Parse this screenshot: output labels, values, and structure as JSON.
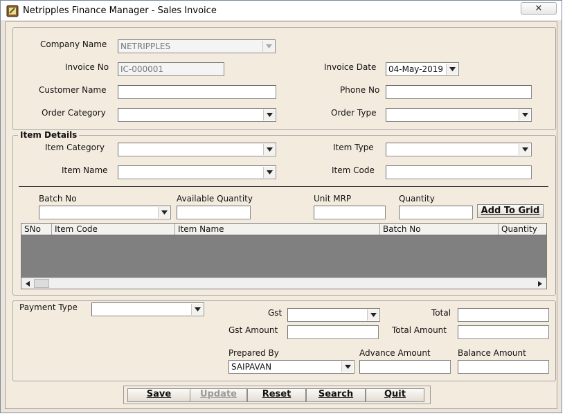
{
  "window": {
    "title": "Netripples Finance Manager - Sales Invoice",
    "close_icon": "close-icon"
  },
  "header": {
    "company_name_label": "Company Name",
    "company_name_value": "NETRIPPLES",
    "invoice_no_label": "Invoice No",
    "invoice_no_value": "IC-000001",
    "invoice_date_label": "Invoice Date",
    "invoice_date_value": "04-May-2019",
    "customer_name_label": "Customer Name",
    "customer_name_value": "",
    "phone_no_label": "Phone No",
    "phone_no_value": "",
    "order_category_label": "Order Category",
    "order_category_value": "",
    "order_type_label": "Order Type",
    "order_type_value": ""
  },
  "item_details": {
    "title": "Item Details",
    "item_category_label": "Item Category",
    "item_type_label": "Item Type",
    "item_name_label": "Item Name",
    "item_code_label": "Item Code",
    "batch_no_label": "Batch No",
    "available_quantity_label": "Available Quantity",
    "unit_mrp_label": "Unit MRP",
    "quantity_label": "Quantity",
    "add_to_grid_label": "Add To Grid",
    "grid_columns": [
      "SNo",
      "Item Code",
      "Item Name",
      "Batch No",
      "Quantity"
    ]
  },
  "payment": {
    "payment_type_label": "Payment Type",
    "gst_label": "Gst",
    "total_label": "Total",
    "gst_amount_label": "Gst Amount",
    "total_amount_label": "Total Amount",
    "prepared_by_label": "Prepared By",
    "prepared_by_value": "SAIPAVAN",
    "advance_amount_label": "Advance Amount",
    "balance_amount_label": "Balance Amount"
  },
  "actions": {
    "save": "Save",
    "update": "Update",
    "reset": "Reset",
    "search": "Search",
    "quit": "Quit"
  }
}
